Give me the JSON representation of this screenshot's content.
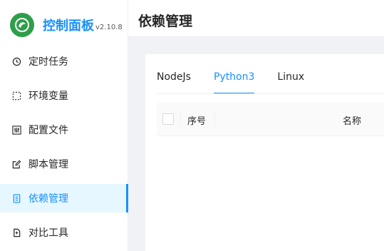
{
  "brand": {
    "title": "控制面板",
    "version": "v2.10.8"
  },
  "sidebar": {
    "items": [
      {
        "label": "定时任务",
        "icon": "clock-icon",
        "active": false
      },
      {
        "label": "环境变量",
        "icon": "variable-icon",
        "active": false
      },
      {
        "label": "配置文件",
        "icon": "sliders-icon",
        "active": false
      },
      {
        "label": "脚本管理",
        "icon": "edit-icon",
        "active": false
      },
      {
        "label": "依赖管理",
        "icon": "package-icon",
        "active": true
      },
      {
        "label": "对比工具",
        "icon": "diff-icon",
        "active": false
      }
    ]
  },
  "header": {
    "title": "依赖管理"
  },
  "tabs": [
    {
      "label": "NodeJs",
      "active": false
    },
    {
      "label": "Python3",
      "active": true
    },
    {
      "label": "Linux",
      "active": false
    }
  ],
  "table": {
    "columns": {
      "index": "序号",
      "name": "名称"
    }
  },
  "colors": {
    "accent": "#1890ff",
    "active_bg": "#e6f7ff",
    "logo": "#2e9e4a"
  }
}
